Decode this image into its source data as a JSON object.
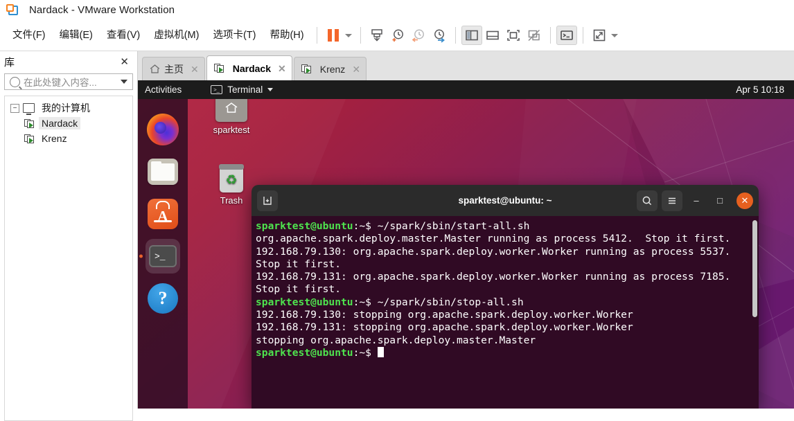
{
  "window": {
    "title": "Nardack - VMware Workstation",
    "logo_icon": "vmware-logo-icon"
  },
  "menubar": {
    "items": [
      {
        "label": "文件(F)",
        "name": "menu-file"
      },
      {
        "label": "编辑(E)",
        "name": "menu-edit"
      },
      {
        "label": "查看(V)",
        "name": "menu-view"
      },
      {
        "label": "虚拟机(M)",
        "name": "menu-vm"
      },
      {
        "label": "选项卡(T)",
        "name": "menu-tabs"
      },
      {
        "label": "帮助(H)",
        "name": "menu-help"
      }
    ],
    "toolbar": [
      {
        "name": "pause-button",
        "icon": "pause-icon"
      },
      {
        "name": "power-dropdown-button",
        "icon": "chevron-down-icon"
      },
      {
        "name": "manage-snapshot-button",
        "icon": "snapshot-icon"
      },
      {
        "name": "take-snapshot-button",
        "icon": "clock-plus-icon"
      },
      {
        "name": "revert-snapshot-button",
        "icon": "clock-back-icon"
      },
      {
        "name": "snapshot-manager-button",
        "icon": "clock-wrench-icon"
      },
      {
        "name": "show-library-button",
        "icon": "sidebar-panel-icon"
      },
      {
        "name": "show-thumbnail-bar-button",
        "icon": "bottom-panel-icon"
      },
      {
        "name": "full-screen-button",
        "icon": "expand-frame-icon"
      },
      {
        "name": "unity-mode-button",
        "icon": "unity-off-icon"
      },
      {
        "name": "console-view-button",
        "icon": "console-icon"
      },
      {
        "name": "stretch-guest-button",
        "icon": "diagonal-arrows-icon"
      },
      {
        "name": "stretch-dropdown-button",
        "icon": "chevron-down-icon"
      }
    ]
  },
  "sidebar": {
    "title": "库",
    "close_label": "✕",
    "search": {
      "placeholder": "在此处键入内容...",
      "value": ""
    },
    "tree": {
      "root": {
        "label": "我的计算机",
        "expander": "−"
      },
      "items": [
        {
          "label": "Nardack",
          "selected": true
        },
        {
          "label": "Krenz",
          "selected": false
        }
      ]
    }
  },
  "tabs": [
    {
      "label": "主页",
      "icon": "home-icon",
      "active": false,
      "close": "✕"
    },
    {
      "label": "Nardack",
      "icon": "vm-icon",
      "active": true,
      "close": "✕"
    },
    {
      "label": "Krenz",
      "icon": "vm-icon",
      "active": false,
      "close": "✕"
    }
  ],
  "guest": {
    "topbar": {
      "activities": "Activities",
      "app_name": "Terminal",
      "app_icon": "terminal-icon",
      "clock": "Apr 5  10:18"
    },
    "dock": [
      {
        "name": "dock-item-firefox",
        "icon": "firefox-icon",
        "running": false
      },
      {
        "name": "dock-item-files",
        "icon": "files-folder-icon",
        "running": false
      },
      {
        "name": "dock-item-ubuntu-software",
        "icon": "ubuntu-software-icon",
        "running": false
      },
      {
        "name": "dock-item-terminal",
        "icon": "terminal-icon",
        "running": true
      },
      {
        "name": "dock-item-help",
        "icon": "help-question-icon",
        "running": false
      }
    ],
    "desktop_icons": [
      {
        "name": "desktop-icon-sparktest",
        "label": "sparktest",
        "icon": "home-folder-icon"
      },
      {
        "name": "desktop-icon-trash",
        "label": "Trash",
        "icon": "trash-icon"
      }
    ],
    "terminal": {
      "title": "sparktest@ubuntu: ~",
      "new_tab_icon": "new-tab-icon",
      "search_icon": "search-icon",
      "menu_icon": "hamburger-menu-icon",
      "minimize_label": "‒",
      "maximize_label": "□",
      "close_label": "✕",
      "lines": [
        {
          "prompt": "sparktest@ubuntu",
          "sep": ":~$ ",
          "cmd": "~/spark/sbin/start-all.sh"
        },
        {
          "text": "org.apache.spark.deploy.master.Master running as process 5412.  Stop it first."
        },
        {
          "text": "192.168.79.130: org.apache.spark.deploy.worker.Worker running as process 5537."
        },
        {
          "text": "Stop it first."
        },
        {
          "text": "192.168.79.131: org.apache.spark.deploy.worker.Worker running as process 7185."
        },
        {
          "text": "Stop it first."
        },
        {
          "prompt": "sparktest@ubuntu",
          "sep": ":~$ ",
          "cmd": "~/spark/sbin/stop-all.sh"
        },
        {
          "text": "192.168.79.130: stopping org.apache.spark.deploy.worker.Worker"
        },
        {
          "text": "192.168.79.131: stopping org.apache.spark.deploy.worker.Worker"
        },
        {
          "text": "stopping org.apache.spark.deploy.master.Master"
        },
        {
          "prompt": "sparktest@ubuntu",
          "sep": ":~$ ",
          "cmd": ""
        }
      ]
    }
  },
  "colors": {
    "accent_orange": "#f4662a",
    "terminal_bg": "#300a24",
    "prompt_green": "#4ee44e",
    "close_button": "#e6601f"
  }
}
